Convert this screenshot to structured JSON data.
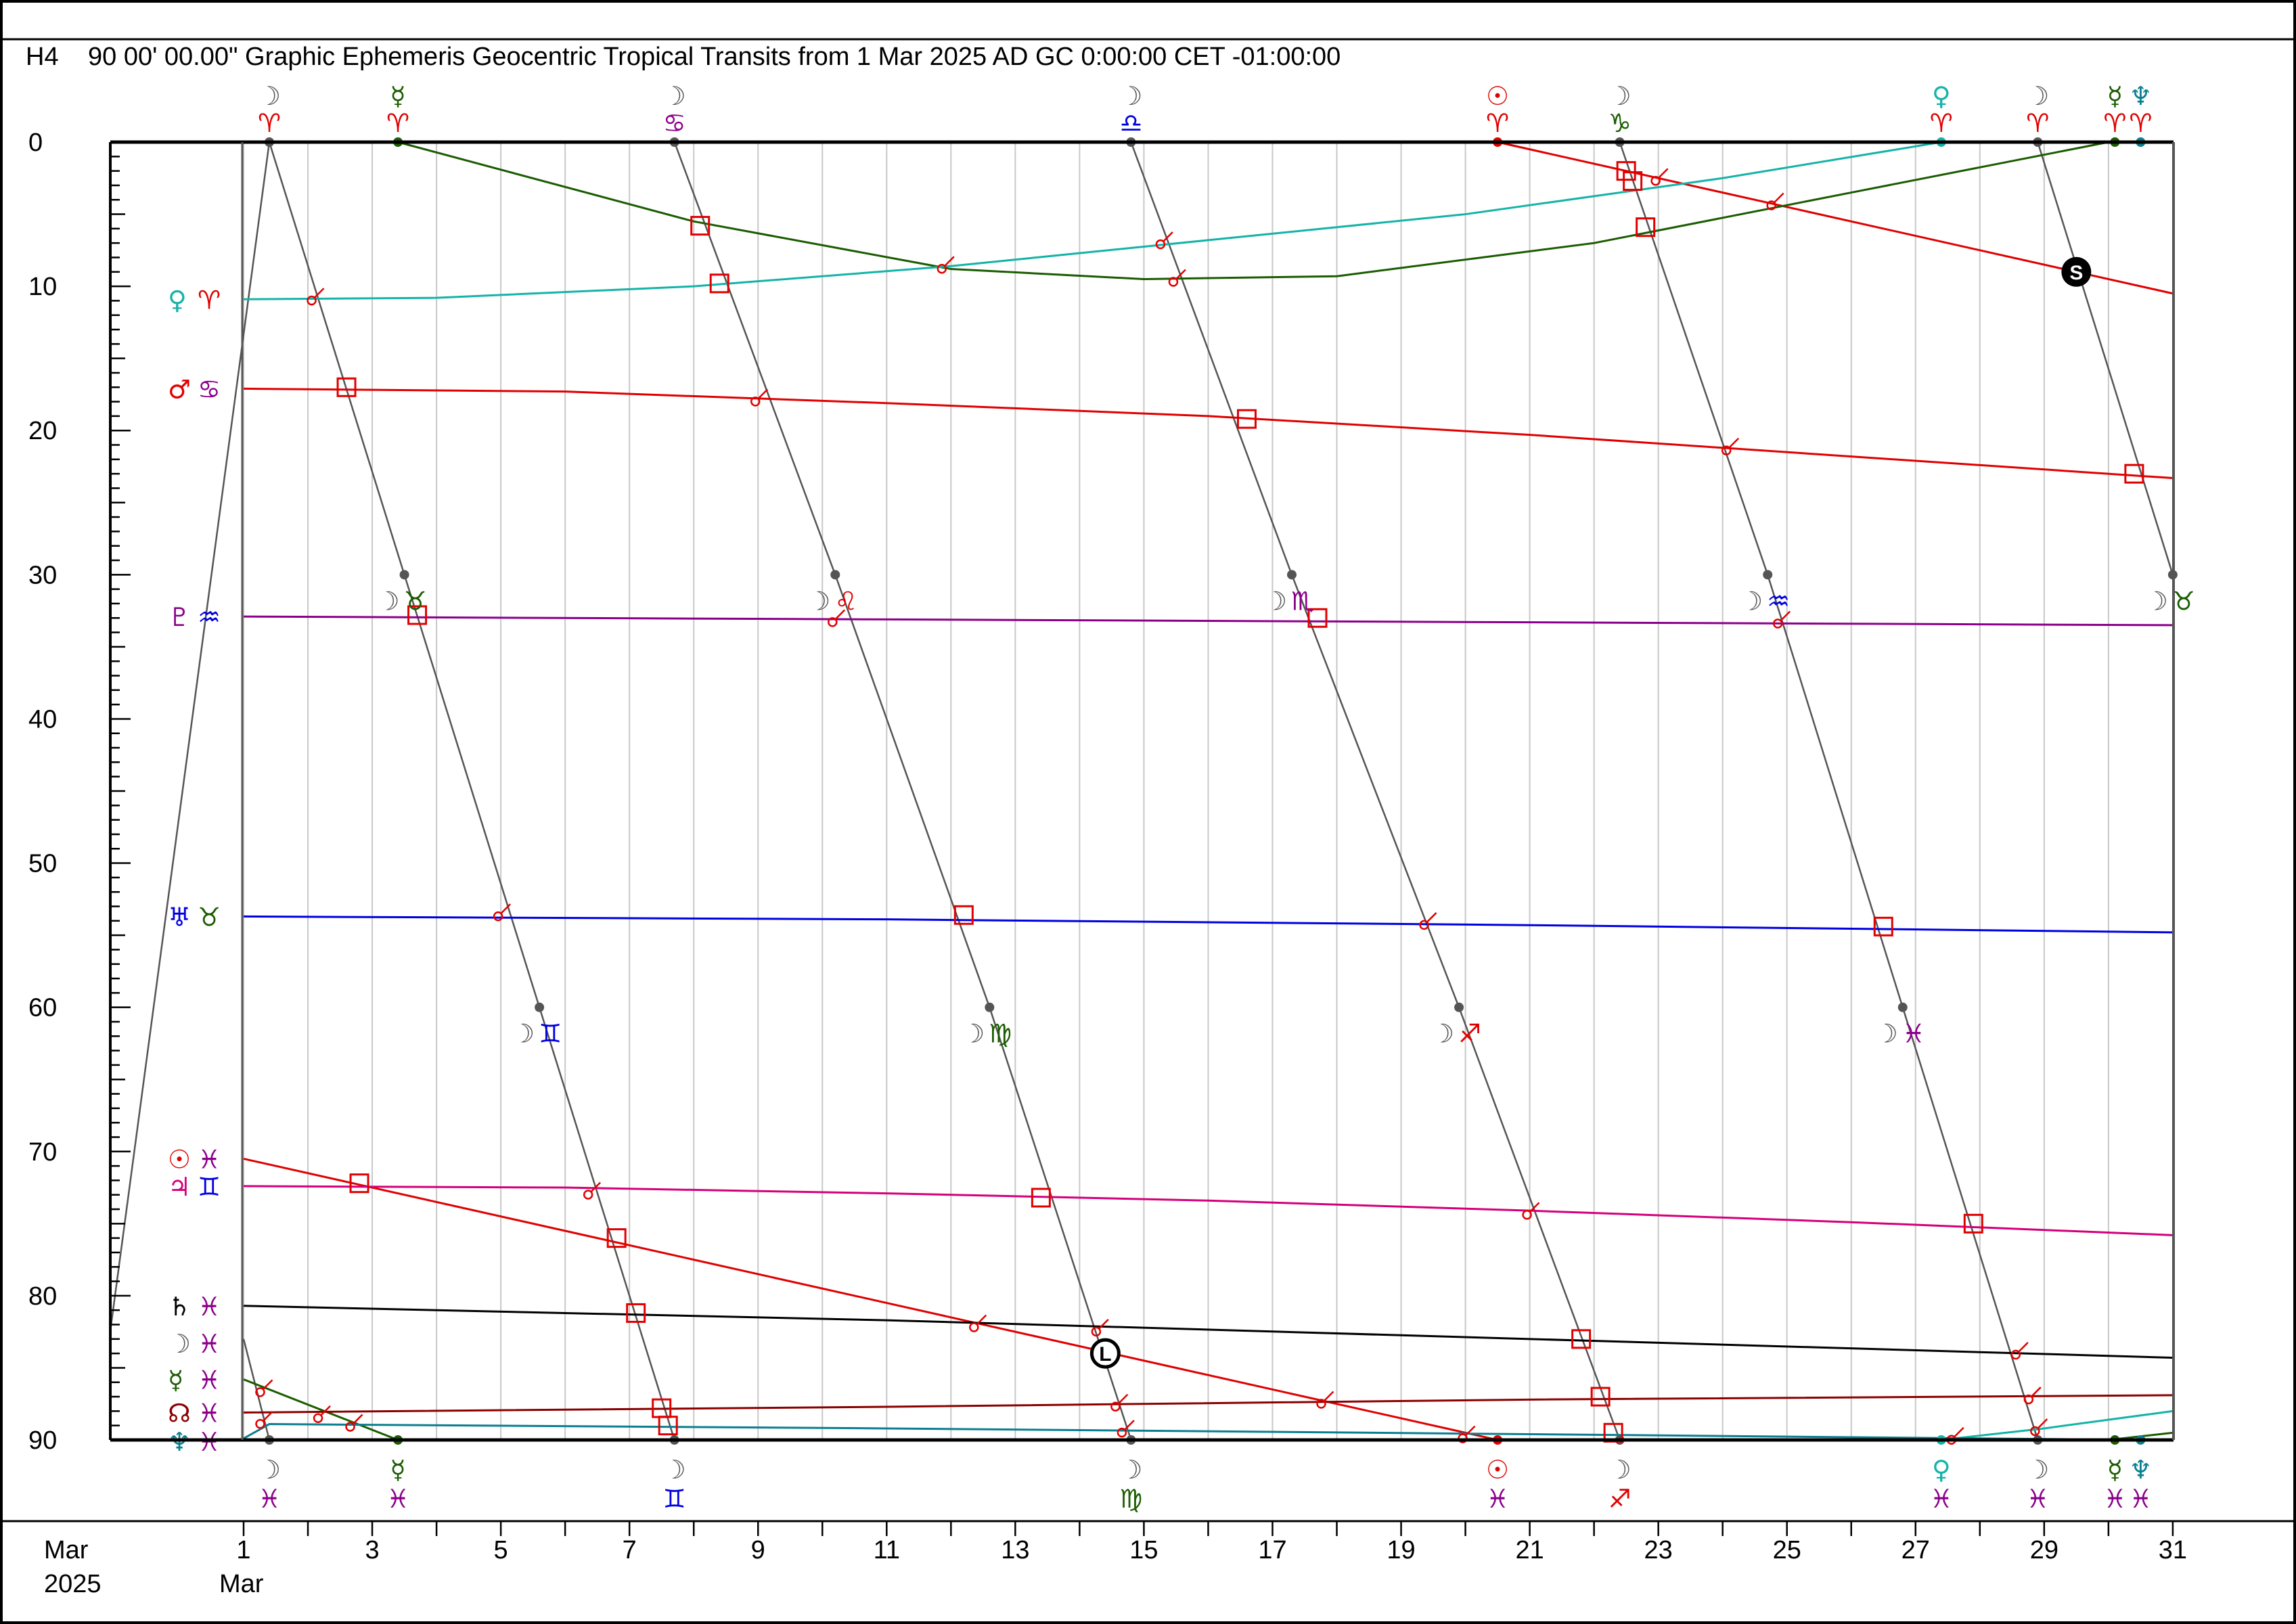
{
  "header": {
    "chart_id": "H4",
    "title": "90 00' 00.00\" Graphic Ephemeris Geocentric Tropical Transits from 1 Mar 2025 AD GC 0:00:00 CET -01:00:00"
  },
  "colors": {
    "sun": "#e00000",
    "moon": "#555555",
    "mercury": "#1a5c00",
    "venus": "#14b3a8",
    "mars": "#e00000",
    "jupiter": "#d4007a",
    "saturn": "#000000",
    "uranus": "#0000e0",
    "neptune": "#0a7f8f",
    "pluto": "#8b008b",
    "node": "#8b0000",
    "aspect": "#e00000",
    "grid": "#c8c8c8"
  },
  "chart_data": {
    "type": "line",
    "title": "90 00' 00.00\" Graphic Ephemeris Geocentric Tropical Transits from 1 Mar 2025 AD GC 0:00:00 CET -01:00:00",
    "xlabel": "",
    "ylabel": "",
    "xlim": [
      1,
      31
    ],
    "ylim": [
      0,
      90
    ],
    "y_inverted": true,
    "grid": true,
    "x_ticks": [
      1,
      3,
      5,
      7,
      9,
      11,
      13,
      15,
      17,
      19,
      21,
      23,
      25,
      27,
      29,
      31
    ],
    "y_ticks": [
      0,
      10,
      20,
      30,
      40,
      50,
      60,
      70,
      80,
      90
    ],
    "x_axis_label_left": [
      "Mar",
      "2025"
    ],
    "x_axis_label_start": "Mar",
    "series": [
      {
        "key": "moon",
        "points": [
          [
            -1.3,
            90
          ],
          [
            1.4,
            0
          ],
          [
            3.5,
            30
          ],
          [
            5.6,
            60
          ],
          [
            7.7,
            90
          ]
        ],
        "segments": [
          [
            1.4,
            0
          ],
          [
            3.5,
            30
          ],
          [
            5.6,
            60
          ],
          [
            7.7,
            90
          ]
        ]
      },
      {
        "key": "moon",
        "points": [
          [
            7.7,
            0
          ],
          [
            10.2,
            30
          ],
          [
            12.6,
            60
          ],
          [
            14.8,
            90
          ]
        ]
      },
      {
        "key": "moon",
        "points": [
          [
            14.8,
            0
          ],
          [
            17.3,
            30
          ],
          [
            19.9,
            60
          ],
          [
            22.4,
            90
          ]
        ]
      },
      {
        "key": "moon",
        "points": [
          [
            22.4,
            0
          ],
          [
            24.7,
            30
          ],
          [
            26.8,
            60
          ],
          [
            28.9,
            90
          ]
        ]
      },
      {
        "key": "moon",
        "points": [
          [
            28.9,
            0
          ],
          [
            31,
            30
          ]
        ]
      },
      {
        "key": "moon",
        "points": [
          [
            1,
            83
          ],
          [
            1.4,
            90
          ]
        ]
      },
      {
        "key": "sun",
        "points": [
          [
            1,
            70.5
          ],
          [
            20.5,
            90
          ]
        ]
      },
      {
        "key": "sun",
        "points": [
          [
            20.5,
            0
          ],
          [
            31,
            10.5
          ]
        ]
      },
      {
        "key": "mercury",
        "points": [
          [
            3.4,
            0
          ],
          [
            8,
            5.5
          ],
          [
            12,
            8.8
          ],
          [
            15,
            9.5
          ],
          [
            18,
            9.3
          ],
          [
            22,
            7
          ],
          [
            26,
            3.5
          ],
          [
            30,
            0
          ]
        ]
      },
      {
        "key": "mercury",
        "points": [
          [
            1,
            85.8
          ],
          [
            3.4,
            90
          ]
        ]
      },
      {
        "key": "mercury",
        "points": [
          [
            30,
            90
          ],
          [
            31,
            89.5
          ]
        ]
      },
      {
        "key": "venus",
        "points": [
          [
            1,
            10.9
          ],
          [
            4,
            10.8
          ],
          [
            8,
            10
          ],
          [
            12,
            8.6
          ],
          [
            16,
            6.8
          ],
          [
            20,
            5
          ],
          [
            24,
            2.5
          ],
          [
            27.4,
            0
          ]
        ]
      },
      {
        "key": "venus",
        "points": [
          [
            27.4,
            90
          ],
          [
            29,
            89.2
          ],
          [
            31,
            88
          ]
        ]
      },
      {
        "key": "mars",
        "points": [
          [
            1,
            17.1
          ],
          [
            6,
            17.3
          ],
          [
            11,
            18.1
          ],
          [
            16,
            19
          ],
          [
            21,
            20.3
          ],
          [
            26,
            21.8
          ],
          [
            31,
            23.3
          ]
        ]
      },
      {
        "key": "jupiter",
        "points": [
          [
            1,
            72.4
          ],
          [
            6,
            72.5
          ],
          [
            11,
            72.9
          ],
          [
            16,
            73.4
          ],
          [
            21,
            74.1
          ],
          [
            26,
            74.9
          ],
          [
            31,
            75.8
          ]
        ]
      },
      {
        "key": "saturn",
        "points": [
          [
            1,
            80.7
          ],
          [
            11,
            81.7
          ],
          [
            21,
            83
          ],
          [
            31,
            84.3
          ]
        ]
      },
      {
        "key": "uranus",
        "points": [
          [
            1,
            53.7
          ],
          [
            11,
            53.9
          ],
          [
            21,
            54.3
          ],
          [
            31,
            54.8
          ]
        ]
      },
      {
        "key": "neptune",
        "points": [
          [
            1,
            89.9
          ],
          [
            1.4,
            88.9
          ],
          [
            11,
            89.2
          ],
          [
            21,
            89.6
          ],
          [
            30.5,
            90
          ]
        ]
      },
      {
        "key": "pluto",
        "points": [
          [
            1,
            32.9
          ],
          [
            11,
            33.1
          ],
          [
            21,
            33.3
          ],
          [
            31,
            33.5
          ]
        ]
      },
      {
        "key": "node",
        "points": [
          [
            1,
            88.1
          ],
          [
            11,
            87.7
          ],
          [
            21,
            87.2
          ],
          [
            31,
            86.9
          ]
        ]
      }
    ],
    "sign_change_dots": [
      {
        "x": 1.4,
        "y": 0,
        "key": "moon"
      },
      {
        "x": 3.4,
        "y": 0,
        "key": "mercury"
      },
      {
        "x": 7.7,
        "y": 0,
        "key": "moon"
      },
      {
        "x": 14.8,
        "y": 0,
        "key": "moon"
      },
      {
        "x": 20.5,
        "y": 0,
        "key": "sun"
      },
      {
        "x": 22.4,
        "y": 0,
        "key": "moon"
      },
      {
        "x": 27.4,
        "y": 0,
        "key": "venus"
      },
      {
        "x": 28.9,
        "y": 0,
        "key": "moon"
      },
      {
        "x": 30.1,
        "y": 0,
        "key": "mercury"
      },
      {
        "x": 30.5,
        "y": 0,
        "key": "neptune"
      },
      {
        "x": 3.5,
        "y": 30,
        "key": "moon"
      },
      {
        "x": 10.2,
        "y": 30,
        "key": "moon"
      },
      {
        "x": 17.3,
        "y": 30,
        "key": "moon"
      },
      {
        "x": 24.7,
        "y": 30,
        "key": "moon"
      },
      {
        "x": 31,
        "y": 30,
        "key": "moon"
      },
      {
        "x": 5.6,
        "y": 60,
        "key": "moon"
      },
      {
        "x": 12.6,
        "y": 60,
        "key": "moon"
      },
      {
        "x": 19.9,
        "y": 60,
        "key": "moon"
      },
      {
        "x": 26.8,
        "y": 60,
        "key": "moon"
      },
      {
        "x": 1.4,
        "y": 90,
        "key": "moon"
      },
      {
        "x": 3.4,
        "y": 90,
        "key": "mercury"
      },
      {
        "x": 7.7,
        "y": 90,
        "key": "moon"
      },
      {
        "x": 14.8,
        "y": 90,
        "key": "moon"
      },
      {
        "x": 20.5,
        "y": 90,
        "key": "sun"
      },
      {
        "x": 22.4,
        "y": 90,
        "key": "moon"
      },
      {
        "x": 27.4,
        "y": 90,
        "key": "venus"
      },
      {
        "x": 28.9,
        "y": 90,
        "key": "moon"
      },
      {
        "x": 30.1,
        "y": 90,
        "key": "mercury"
      },
      {
        "x": 30.5,
        "y": 90,
        "key": "neptune"
      }
    ],
    "aspects_square": [
      [
        8.1,
        5.8
      ],
      [
        8.4,
        9.8
      ],
      [
        2.6,
        17
      ],
      [
        3.7,
        32.8
      ],
      [
        12.2,
        53.6
      ],
      [
        16.6,
        19.2
      ],
      [
        17.7,
        33
      ],
      [
        22.5,
        2
      ],
      [
        22.6,
        2.7
      ],
      [
        22.8,
        5.9
      ],
      [
        26.5,
        54.4
      ],
      [
        30.4,
        23
      ],
      [
        2.8,
        72.2
      ],
      [
        6.8,
        76
      ],
      [
        7.1,
        81.2
      ],
      [
        7.5,
        87.8
      ],
      [
        7.6,
        89
      ],
      [
        13.4,
        73.2
      ],
      [
        21.8,
        83
      ],
      [
        22.1,
        87
      ],
      [
        22.3,
        89.5
      ],
      [
        27.9,
        75
      ]
    ],
    "aspects_conjunction": [
      [
        2.1,
        10.8
      ],
      [
        9.0,
        17.8
      ],
      [
        5.0,
        53.5
      ],
      [
        11.9,
        8.6
      ],
      [
        15.3,
        6.9
      ],
      [
        15.5,
        9.5
      ],
      [
        10.2,
        33.1
      ],
      [
        19.4,
        54.1
      ],
      [
        24.1,
        21.2
      ],
      [
        23.0,
        2.5
      ],
      [
        24.8,
        4.2
      ],
      [
        24.9,
        33.2
      ],
      [
        6.4,
        72.8
      ],
      [
        12.4,
        82
      ],
      [
        14.3,
        82.3
      ],
      [
        14.6,
        87.5
      ],
      [
        14.7,
        89.3
      ],
      [
        17.8,
        87.3
      ],
      [
        20.0,
        89.7
      ],
      [
        21.0,
        74.2
      ],
      [
        1.3,
        86.5
      ],
      [
        1.3,
        88.7
      ],
      [
        2.2,
        88.3
      ],
      [
        2.7,
        88.9
      ],
      [
        27.6,
        89.8
      ],
      [
        28.6,
        83.9
      ],
      [
        28.8,
        87
      ],
      [
        28.9,
        89.2
      ]
    ],
    "stations": [
      {
        "x": 29.5,
        "y": 9,
        "label": "S"
      },
      {
        "x": 14.4,
        "y": 84,
        "label": "L"
      }
    ],
    "left_labels": [
      {
        "y": 10.9,
        "planet": "♀",
        "sign": "♈",
        "pkey": "venus",
        "skey": "fire"
      },
      {
        "y": 17.1,
        "planet": "♂",
        "sign": "♋",
        "pkey": "mars",
        "skey": "water"
      },
      {
        "y": 32.9,
        "planet": "♇",
        "sign": "♒",
        "pkey": "pluto",
        "skey": "air"
      },
      {
        "y": 53.7,
        "planet": "♅",
        "sign": "♉",
        "pkey": "uranus",
        "skey": "earth"
      },
      {
        "y": 70.5,
        "planet": "☉",
        "sign": "♓",
        "pkey": "sun",
        "skey": "water"
      },
      {
        "y": 72.4,
        "planet": "♃",
        "sign": "♊",
        "pkey": "jupiter",
        "skey": "air"
      },
      {
        "y": 80.7,
        "planet": "♄",
        "sign": "♓",
        "pkey": "saturn",
        "skey": "water"
      },
      {
        "y": 83.3,
        "planet": "☽",
        "sign": "♓",
        "pkey": "moon",
        "skey": "water"
      },
      {
        "y": 85.8,
        "planet": "☿",
        "sign": "♓",
        "pkey": "mercury",
        "skey": "water"
      },
      {
        "y": 88.1,
        "planet": "☊",
        "sign": "♓",
        "pkey": "node",
        "skey": "water"
      },
      {
        "y": 90.1,
        "planet": "♆",
        "sign": "♓",
        "pkey": "neptune",
        "skey": "water"
      }
    ],
    "top_labels": [
      {
        "x": 1.4,
        "planet": "☽",
        "sign": "♈",
        "pkey": "moon",
        "skey": "fire"
      },
      {
        "x": 3.4,
        "planet": "☿",
        "sign": "♈",
        "pkey": "mercury",
        "skey": "fire"
      },
      {
        "x": 7.7,
        "planet": "☽",
        "sign": "♋",
        "pkey": "moon",
        "skey": "water"
      },
      {
        "x": 14.8,
        "planet": "☽",
        "sign": "♎",
        "pkey": "moon",
        "skey": "air"
      },
      {
        "x": 20.5,
        "planet": "☉",
        "sign": "♈",
        "pkey": "sun",
        "skey": "fire"
      },
      {
        "x": 22.4,
        "planet": "☽",
        "sign": "♑",
        "pkey": "moon",
        "skey": "earth"
      },
      {
        "x": 27.4,
        "planet": "♀",
        "sign": "♈",
        "pkey": "venus",
        "skey": "fire"
      },
      {
        "x": 28.9,
        "planet": "☽",
        "sign": "♈",
        "pkey": "moon",
        "skey": "fire"
      },
      {
        "x": 30.1,
        "planet": "☿",
        "sign": "♈",
        "pkey": "mercury",
        "skey": "fire"
      },
      {
        "x": 30.5,
        "planet": "♆",
        "sign": "♈",
        "pkey": "neptune",
        "skey": "fire"
      }
    ],
    "bottom_labels": [
      {
        "x": 1.4,
        "planet": "☽",
        "sign": "♓",
        "pkey": "moon",
        "skey": "water"
      },
      {
        "x": 3.4,
        "planet": "☿",
        "sign": "♓",
        "pkey": "mercury",
        "skey": "water"
      },
      {
        "x": 7.7,
        "planet": "☽",
        "sign": "♊",
        "pkey": "moon",
        "skey": "air"
      },
      {
        "x": 14.8,
        "planet": "☽",
        "sign": "♍",
        "pkey": "moon",
        "skey": "earth"
      },
      {
        "x": 20.5,
        "planet": "☉",
        "sign": "♓",
        "pkey": "sun",
        "skey": "water"
      },
      {
        "x": 22.4,
        "planet": "☽",
        "sign": "♐",
        "pkey": "moon",
        "skey": "fire"
      },
      {
        "x": 27.4,
        "planet": "♀",
        "sign": "♓",
        "pkey": "venus",
        "skey": "water"
      },
      {
        "x": 28.9,
        "planet": "☽",
        "sign": "♓",
        "pkey": "moon",
        "skey": "water"
      },
      {
        "x": 30.1,
        "planet": "☿",
        "sign": "♓",
        "pkey": "mercury",
        "skey": "water"
      },
      {
        "x": 30.5,
        "planet": "♆",
        "sign": "♓",
        "pkey": "neptune",
        "skey": "water"
      }
    ],
    "mid_labels": [
      {
        "x": 3.5,
        "y": 30,
        "planet": "☽",
        "sign": "♉",
        "skey": "earth"
      },
      {
        "x": 10.2,
        "y": 30,
        "planet": "☽",
        "sign": "♌",
        "skey": "fire"
      },
      {
        "x": 17.3,
        "y": 30,
        "planet": "☽",
        "sign": "♏",
        "skey": "water"
      },
      {
        "x": 24.7,
        "y": 30,
        "planet": "☽",
        "sign": "♒",
        "skey": "air"
      },
      {
        "x": 31,
        "y": 30,
        "planet": "☽",
        "sign": "♉",
        "skey": "earth"
      },
      {
        "x": 5.6,
        "y": 60,
        "planet": "☽",
        "sign": "♊",
        "skey": "air"
      },
      {
        "x": 12.6,
        "y": 60,
        "planet": "☽",
        "sign": "♍",
        "skey": "earth"
      },
      {
        "x": 19.9,
        "y": 60,
        "planet": "☽",
        "sign": "♐",
        "skey": "fire"
      },
      {
        "x": 26.8,
        "y": 60,
        "planet": "☽",
        "sign": "♓",
        "skey": "water"
      }
    ],
    "sign_colors": {
      "fire": "#e00000",
      "earth": "#1a5c00",
      "air": "#0000e0",
      "water": "#8b008b"
    }
  }
}
